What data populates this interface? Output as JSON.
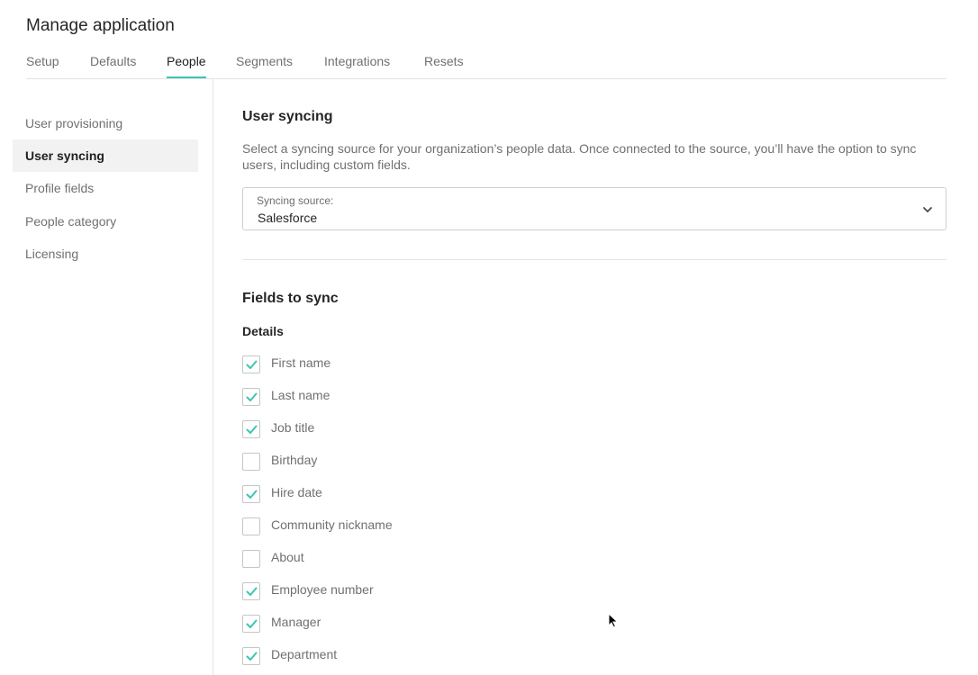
{
  "header": {
    "title": "Manage application"
  },
  "tabs": [
    {
      "label": "Setup",
      "active": false
    },
    {
      "label": "Defaults",
      "active": false
    },
    {
      "label": "People",
      "active": true
    },
    {
      "label": "Segments",
      "active": false
    },
    {
      "label": "Integrations",
      "active": false
    },
    {
      "label": "Resets",
      "active": false
    }
  ],
  "sidebar": {
    "items": [
      {
        "label": "User provisioning",
        "active": false
      },
      {
        "label": "User syncing",
        "active": true
      },
      {
        "label": "Profile fields",
        "active": false
      },
      {
        "label": "People category",
        "active": false
      },
      {
        "label": "Licensing",
        "active": false
      }
    ]
  },
  "user_syncing": {
    "title": "User syncing",
    "description": "Select a syncing source for your organization’s people data. Once connected to the source, you’ll have the option to sync users, including custom fields.",
    "source_label": "Syncing source:",
    "source_value": "Salesforce"
  },
  "fields_to_sync": {
    "title": "Fields to sync",
    "group_label": "Details",
    "fields": [
      {
        "label": "First name",
        "checked": true
      },
      {
        "label": "Last name",
        "checked": true
      },
      {
        "label": "Job title",
        "checked": true
      },
      {
        "label": "Birthday",
        "checked": false
      },
      {
        "label": "Hire date",
        "checked": true
      },
      {
        "label": "Community nickname",
        "checked": false
      },
      {
        "label": "About",
        "checked": false
      },
      {
        "label": "Employee number",
        "checked": true
      },
      {
        "label": "Manager",
        "checked": true
      },
      {
        "label": "Department",
        "checked": true
      }
    ]
  },
  "colors": {
    "accent": "#3ec4b1",
    "active_bg": "#f2f2f2",
    "border": "#e3e3e3"
  },
  "icons": {
    "checkbox_check": "check-icon",
    "select_chevron": "chevron-down-icon",
    "cursor": "mouse-pointer-icon"
  }
}
